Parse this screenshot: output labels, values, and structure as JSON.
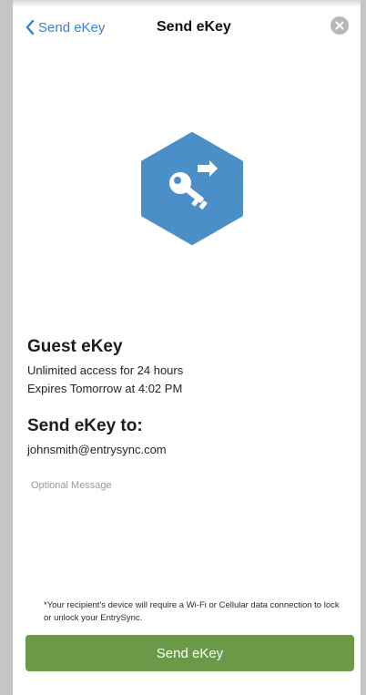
{
  "navbar": {
    "back_label": "Send eKey",
    "title": "Send eKey"
  },
  "icons": {
    "back": "chevron-left-icon",
    "close": "close-icon",
    "badge": "key-share-icon"
  },
  "colors": {
    "link": "#3c7fd6",
    "badge": "#4a8fc8",
    "button": "#6a9a47"
  },
  "guest": {
    "title": "Guest eKey",
    "access": "Unlimited access for 24 hours",
    "expires": "Expires Tomorrow at 4:02 PM"
  },
  "send_to": {
    "title": "Send eKey to:",
    "email": "johnsmith@entrysync.com"
  },
  "message": {
    "placeholder": "Optional Message",
    "value": ""
  },
  "disclaimer": "*Your recipient's device will require a Wi-Fi or Cellular data connection to lock or unlock your EntrySync.",
  "send_button": {
    "label": "Send eKey"
  }
}
